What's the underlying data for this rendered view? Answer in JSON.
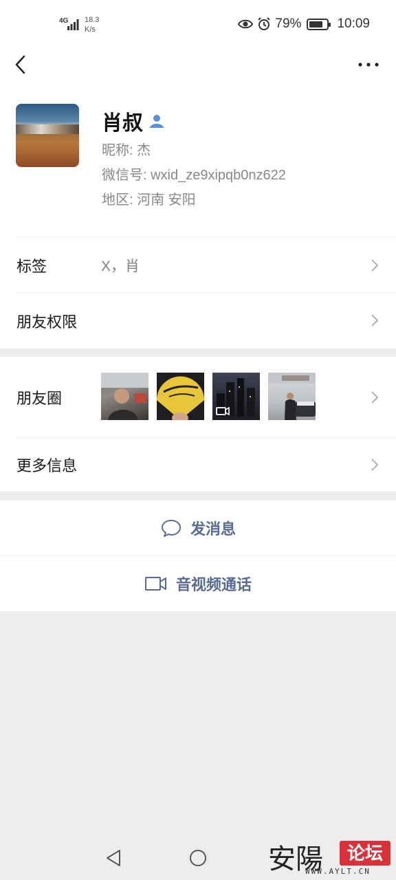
{
  "status_bar": {
    "network": "4G",
    "speed_value": "18.3",
    "speed_unit": "K/s",
    "battery": "79%",
    "battery_level": 0.79,
    "time": "10:09"
  },
  "profile": {
    "name": "肖叔",
    "nickname": "昵称:  杰",
    "wechat_id": "微信号:  wxid_ze9xipqb0nz622",
    "region": "地区:  河南  安阳"
  },
  "rows": {
    "tags_label": "标签",
    "tags_value": "X，肖",
    "permissions_label": "朋友权限",
    "moments_label": "朋友圈",
    "more_info_label": "更多信息"
  },
  "actions": {
    "message": "发消息",
    "call": "音视频通话"
  },
  "watermark": {
    "chars": "安陽",
    "badge": "论坛",
    "url": "WWW.AYLT.CN"
  }
}
